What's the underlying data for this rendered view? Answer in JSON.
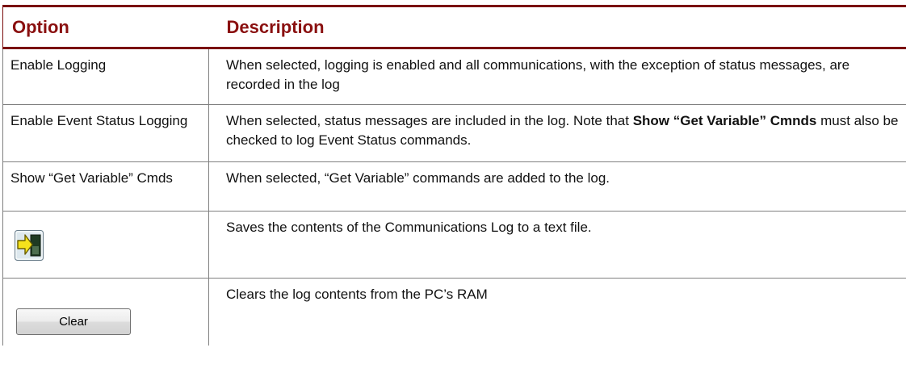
{
  "header": {
    "option": "Option",
    "description": "Description"
  },
  "rows": [
    {
      "option": "Enable Logging",
      "description": "When selected, logging is enabled and all communications, with the exception of status messages, are recorded in the log"
    },
    {
      "option": "Enable Event Status Logging",
      "description_pre": "When selected, status messages are included in the log. Note that ",
      "description_bold": "Show “Get Variable” Cmnds",
      "description_post": " must also be checked to log Event Status commands."
    },
    {
      "option": "Show “Get Variable” Cmds",
      "description": "When selected, “Get Variable” commands are added to the log."
    },
    {
      "option_icon": "save-to-file-icon",
      "description": "Saves the contents of the Communications Log to a text file."
    },
    {
      "option_button": "Clear",
      "description": "Clears the log contents from the PC’s RAM"
    }
  ],
  "colors": {
    "header_text": "#8a1010",
    "header_rule": "#7a0c0c",
    "cell_border": "#808080"
  }
}
